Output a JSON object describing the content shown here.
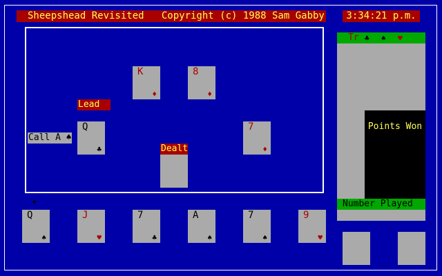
{
  "header": {
    "title": "Sheepshead Revisited   Copyright (c) 1988 Sam Gabby",
    "clock": "3:34:21 p.m."
  },
  "table": {
    "trick_cards": [
      {
        "rank": "K",
        "suit": "♦",
        "color": "red"
      },
      {
        "rank": "8",
        "suit": "♦",
        "color": "red"
      },
      {
        "rank": "Q",
        "suit": "♣",
        "color": "black"
      },
      {
        "rank": "7",
        "suit": "♦",
        "color": "red"
      },
      {
        "rank": "",
        "suit": "",
        "color": "black"
      }
    ],
    "lead_label": "Lead",
    "dealt_label": "Dealt",
    "call_label": "Call A ♠"
  },
  "hand": {
    "pointer": "▼",
    "cards": [
      {
        "rank": "Q",
        "suit": "♠",
        "color": "black"
      },
      {
        "rank": "J",
        "suit": "♥",
        "color": "red"
      },
      {
        "rank": "7",
        "suit": "♣",
        "color": "black"
      },
      {
        "rank": "A",
        "suit": "♠",
        "color": "black"
      },
      {
        "rank": "7",
        "suit": "♠",
        "color": "black"
      },
      {
        "rank": "9",
        "suit": "♥",
        "color": "red"
      }
    ]
  },
  "panel": {
    "trump_label": "Tr",
    "trump_suits": [
      "♣",
      "♠",
      "♥"
    ],
    "points_won_label": "Points Won",
    "number_played_label": "Number Played"
  },
  "colors": {
    "background": "#0000a8",
    "title_bar": "#a80000",
    "title_text": "#ffff55",
    "card": "#aaaaaa",
    "status_green": "#00a800"
  }
}
